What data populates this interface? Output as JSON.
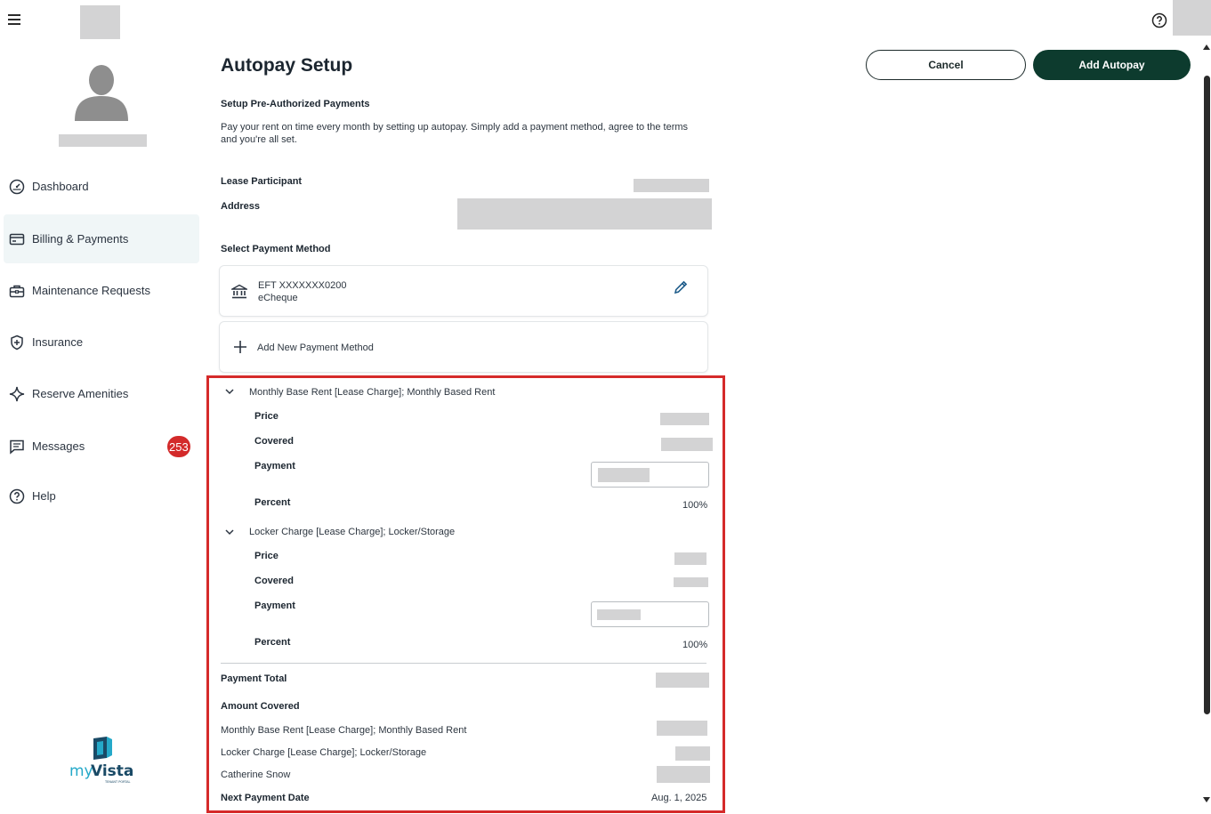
{
  "page": {
    "title": "Autopay Setup",
    "cancel_label": "Cancel",
    "add_label": "Add Autopay",
    "section_title": "Setup Pre-Authorized Payments",
    "description": "Pay your rent on time every month by setting up autopay. Simply add a payment method, agree to the terms and you're all set.",
    "lease_participant_label": "Lease Participant",
    "address_label": "Address",
    "select_method_label": "Select Payment Method"
  },
  "sidebar": {
    "items": [
      {
        "label": "Dashboard",
        "icon": "dashboard-gauge-icon"
      },
      {
        "label": "Billing & Payments",
        "icon": "credit-card-icon",
        "active": true
      },
      {
        "label": "Maintenance Requests",
        "icon": "toolbox-icon"
      },
      {
        "label": "Insurance",
        "icon": "shield-plus-icon"
      },
      {
        "label": "Reserve Amenities",
        "icon": "sparkle-icon"
      },
      {
        "label": "Messages",
        "icon": "message-icon",
        "badge": "253"
      },
      {
        "label": "Help",
        "icon": "help-circle-icon"
      }
    ]
  },
  "payment_method": {
    "name": "EFT XXXXXXX0200",
    "type": "eCheque",
    "add_new_label": "Add New Payment Method"
  },
  "charges": [
    {
      "name": "Monthly Base Rent [Lease Charge]; Monthly Based Rent",
      "price_label": "Price",
      "covered_label": "Covered",
      "payment_label": "Payment",
      "percent_label": "Percent",
      "percent": "100%"
    },
    {
      "name": "Locker Charge [Lease Charge]; Locker/Storage",
      "price_label": "Price",
      "covered_label": "Covered",
      "payment_label": "Payment",
      "percent_label": "Percent",
      "percent": "100%"
    }
  ],
  "summary": {
    "total_label": "Payment Total",
    "covered_label": "Amount Covered",
    "rows": [
      "Monthly Base Rent [Lease Charge]; Monthly Based Rent",
      "Locker Charge [Lease Charge]; Locker/Storage",
      "Catherine Snow"
    ],
    "next_date_label": "Next Payment Date",
    "next_date": "Aug. 1, 2025"
  },
  "colors": {
    "accent_dark": "#0d3b2e",
    "badge": "#d32a2a",
    "highlight_border": "#d52a2a",
    "active_nav_bg": "#f0f6f7"
  }
}
